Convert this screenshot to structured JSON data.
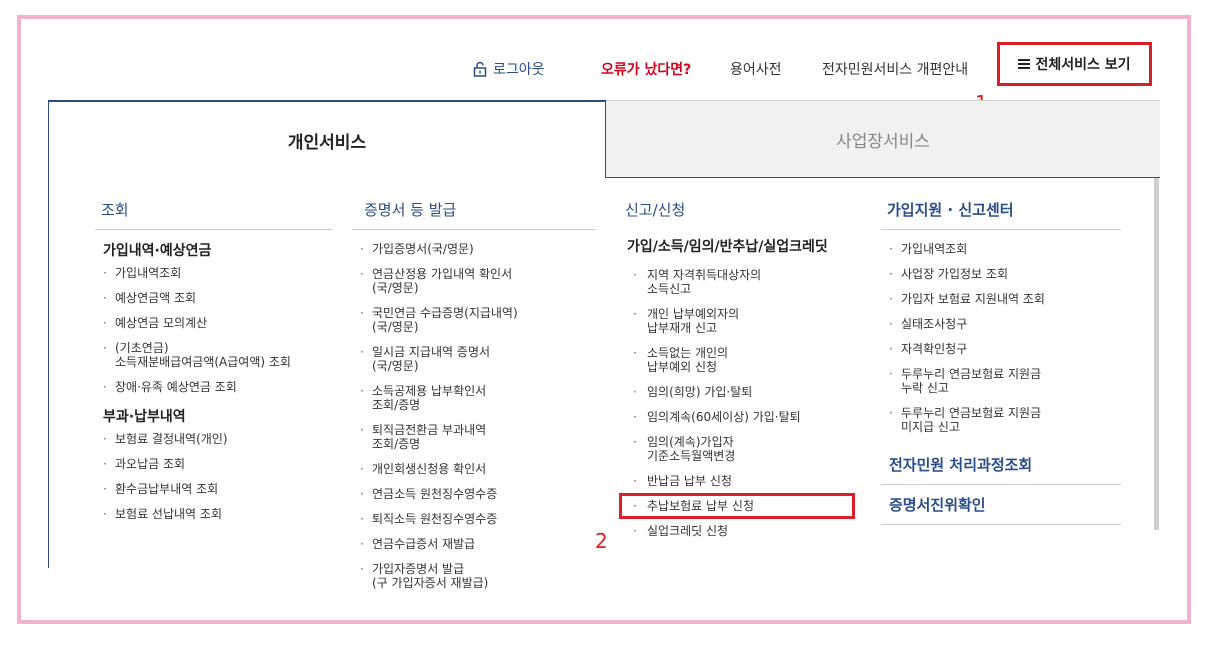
{
  "topnav": {
    "logout": "로그아웃",
    "error": "오류가 났다면?",
    "dictionary": "용어사전",
    "notice": "전자민원서비스 개편안내",
    "all_services": "전체서비스 보기"
  },
  "annotations": {
    "one": "1",
    "two": "2"
  },
  "tabs": {
    "personal": "개인서비스",
    "business": "사업장서비스"
  },
  "columns": {
    "inquiry": {
      "title": "조회",
      "group1": {
        "title": "가입내역·예상연금",
        "items": [
          "가입내역조회",
          "예상연금액 조회",
          "예상연금 모의계산",
          "(기초연금)\n소득재분배급여금액(A급여액) 조회",
          "장애·유족 예상연금 조회"
        ]
      },
      "group2": {
        "title": "부과·납부내역",
        "items": [
          "보험료 결정내역(개인)",
          "과오납금 조회",
          "환수금납부내역 조회",
          "보험료 선납내역 조회"
        ]
      }
    },
    "certificate": {
      "title": "증명서 등 발급",
      "items": [
        "가입증명서(국/영문)",
        "연금산정용 가입내역 확인서\n(국/영문)",
        "국민연금 수급증명(지급내역)\n(국/영문)",
        "일시금 지급내역 증명서\n(국/영문)",
        "소득공제용 납부확인서\n조회/증명",
        "퇴직금전환금 부과내역\n조회/증명",
        "개인회생신청용 확인서",
        "연금소득 원천징수영수증",
        "퇴직소득 원천징수영수증",
        "연금수급증서 재발급",
        "가입자증명서 발급\n(구 가입자증서 재발급)"
      ]
    },
    "report": {
      "title": "신고/신청",
      "group1": {
        "title": "가입/소득/임의/반추납/실업크레딧",
        "items": [
          "지역 자격취득대상자의\n소득신고",
          "개인 납부예외자의\n납부재개 신고",
          "소득없는 개인의\n납부예외 신청",
          "임의(희망) 가입·탈퇴",
          "임의계속(60세이상) 가입·탈퇴",
          "임의(계속)가입자\n기준소득월액변경",
          "반납금 납부 신청",
          "추납보험료 납부 신청",
          "실업크레딧 신청"
        ]
      }
    },
    "support": {
      "title": "가입지원 · 신고센터",
      "items": [
        "가입내역조회",
        "사업장 가입정보 조회",
        "가입자 보험료 지원내역 조회",
        "실태조사청구",
        "자격확인청구",
        "두루누리 연금보험료 지원금\n누락 신고",
        "두루누리 연금보험료 지원금\n미지급 신고"
      ],
      "extra1": "전자민원 처리과정조회",
      "extra2": "증명서진위확인"
    }
  },
  "colors": {
    "accent": "#2b4d8a",
    "highlight": "#d91f2a",
    "frame": "#f4b3cd",
    "error": "#d0021b"
  }
}
